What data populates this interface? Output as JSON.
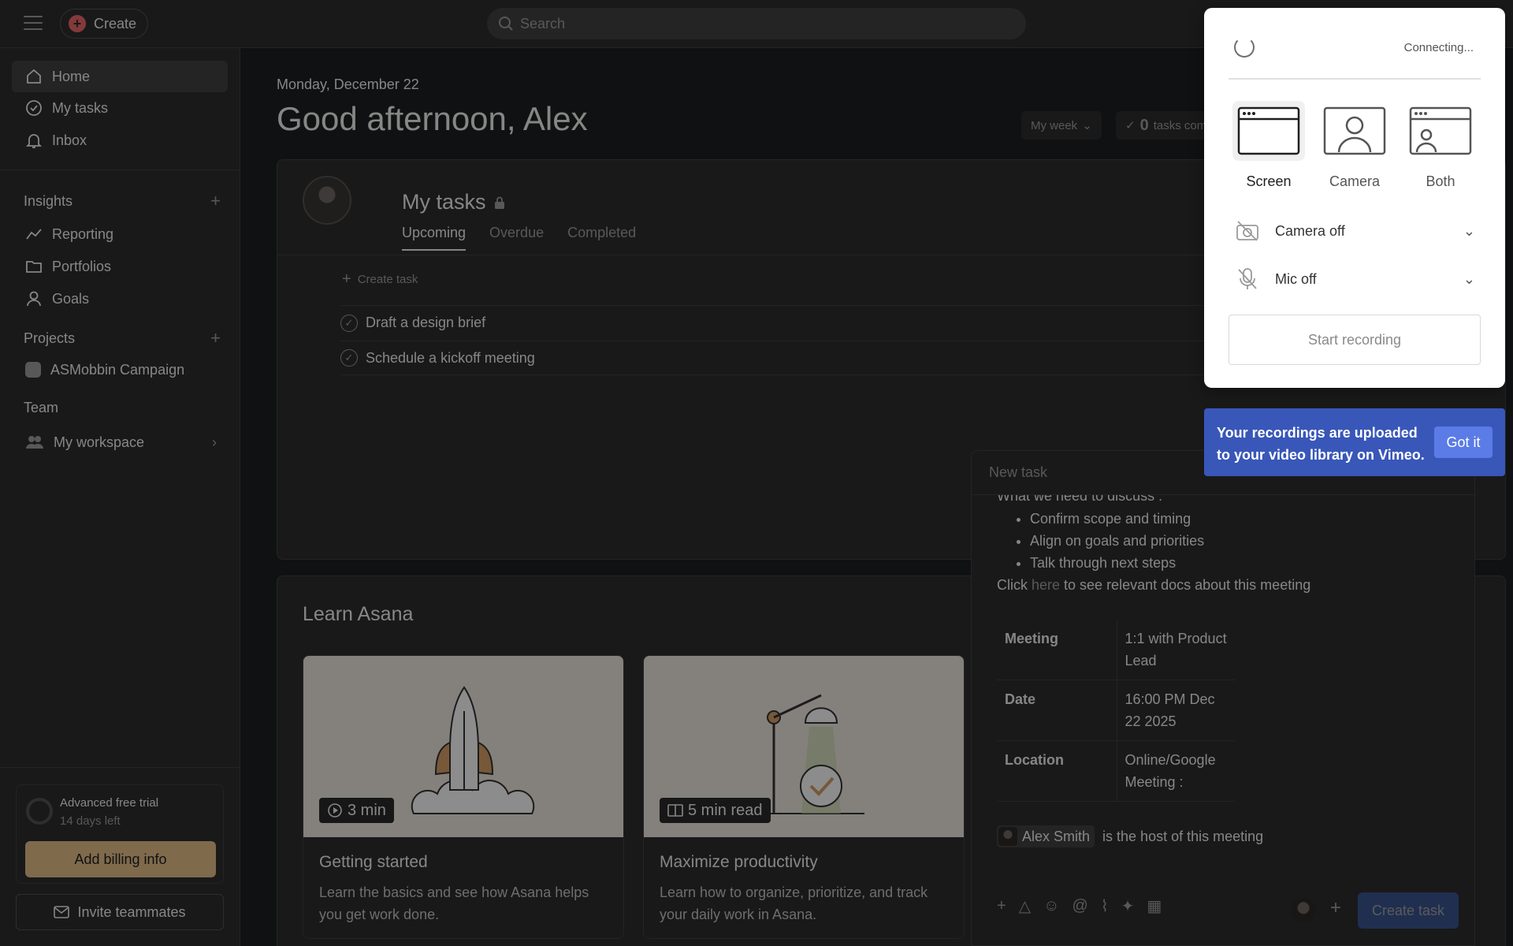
{
  "topbar": {
    "create_label": "Create",
    "search_placeholder": "Search"
  },
  "sidebar": {
    "nav": [
      {
        "label": "Home",
        "icon": "home-icon",
        "active": true
      },
      {
        "label": "My tasks",
        "icon": "check-circle-icon"
      },
      {
        "label": "Inbox",
        "icon": "bell-icon"
      }
    ],
    "insights_label": "Insights",
    "insights_items": [
      {
        "label": "Reporting",
        "icon": "chart-line-icon"
      },
      {
        "label": "Portfolios",
        "icon": "folder-icon"
      },
      {
        "label": "Goals",
        "icon": "person-icon"
      }
    ],
    "projects_label": "Projects",
    "projects": [
      {
        "label": "ASMobbin Campaign",
        "color": "#9ea0a4"
      }
    ],
    "team_label": "Team",
    "team_item": "My workspace",
    "trial": {
      "title": "Advanced free trial",
      "days_left": "14 days left",
      "billing_label": "Add billing info",
      "billing_color": "#e8c18a"
    },
    "invite_label": "Invite teammates"
  },
  "main": {
    "date": "Monday, December 22",
    "greeting": "Good afternoon, Alex",
    "week_filter": "My week",
    "tasks_done_count": "0",
    "tasks_done_label": "tasks com"
  },
  "my_tasks": {
    "title": "My tasks",
    "tabs": [
      "Upcoming",
      "Overdue",
      "Completed"
    ],
    "create_task_label": "Create task",
    "tasks": [
      "Draft a design brief",
      "Schedule a kickoff meeting"
    ]
  },
  "learn": {
    "title": "Learn Asana",
    "cards": [
      {
        "badge": "3 min",
        "title": "Getting started",
        "desc": "Learn the basics and see how Asana helps you get work done."
      },
      {
        "badge": "5 min read",
        "title": "Maximize productivity",
        "desc": "Learn how to organize, prioritize, and track your daily work in Asana."
      }
    ]
  },
  "new_task": {
    "header": "New task",
    "cut_line": "What we need to discuss :",
    "bullets": [
      "Confirm scope and timing",
      "Align on goals and priorities",
      "Talk through next steps"
    ],
    "click_prefix": "Click ",
    "click_link": "here",
    "click_suffix": " to see relevant docs about this meeting",
    "table": [
      {
        "k": "Meeting",
        "v": "1:1 with Product Lead"
      },
      {
        "k": "Date",
        "v": "16:00 PM Dec 22 2025"
      },
      {
        "k": "Location",
        "v": "Online/Google Meeting :"
      }
    ],
    "host_name": "Alex Smith",
    "host_suffix": "is the host of this meeting",
    "create_label": "Create task",
    "create_color": "#4573d2"
  },
  "recorder": {
    "status": "Connecting...",
    "modes": [
      "Screen",
      "Camera",
      "Both"
    ],
    "camera_option": "Camera off",
    "mic_option": "Mic off",
    "start_label": "Start recording"
  },
  "tooltip": {
    "text": "Your recordings are uploaded to your video library on Vimeo.",
    "button": "Got it",
    "color": "#3957b8"
  }
}
